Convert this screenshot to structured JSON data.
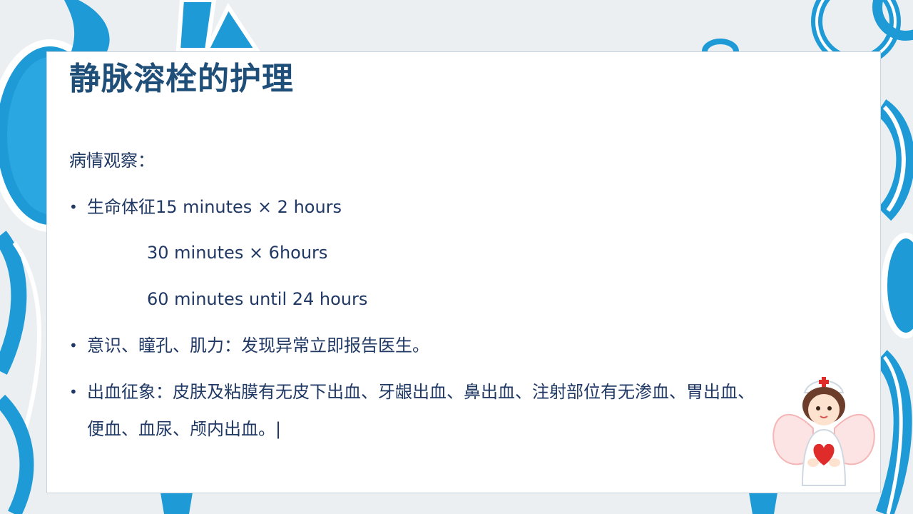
{
  "slide": {
    "title": "静脉溶栓的护理",
    "section_label": "病情观察：",
    "bullets": [
      {
        "lines": [
          "生命体征15 minutes × 2 hours"
        ],
        "sub_lines": [
          "30 minutes × 6hours",
          "60 minutes until 24 hours"
        ]
      },
      {
        "lines": [
          "意识、瞳孔、肌力：发现异常立即报告医生。"
        ]
      },
      {
        "lines": [
          "出血征象：皮肤及粘膜有无皮下出血、牙龈出血、鼻出血、注射部位有无渗血、胃出血、",
          "便血、血尿、颅内出血。|"
        ]
      }
    ],
    "bullet_symbol": "•"
  },
  "colors": {
    "title": "#1f4e79",
    "body_text": "#1f3864",
    "accent_blue": "#1e9ad6",
    "card_bg": "#ffffff"
  }
}
